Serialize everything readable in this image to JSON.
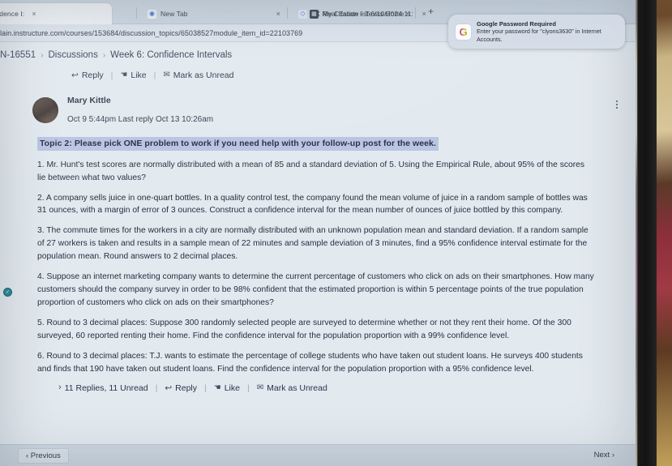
{
  "browser": {
    "tabs": [
      {
        "label": "nfidence I:",
        "favicon": "",
        "active": true,
        "close": "×"
      },
      {
        "label": "New Tab",
        "favicon": "chrome-icon",
        "active": false,
        "close": "×"
      },
      {
        "label": "TX Real Estate - Texas Home",
        "favicon": "folder-icon",
        "active": false,
        "close": "×"
      },
      {
        "label": "My Citation list 6/10/2024 11:",
        "favicon": "document-icon",
        "active": false,
        "close": "×"
      }
    ],
    "new_tab_button": "+",
    "url": "lain.instructure.com/courses/153684/discussion_topics/65038527module_item_id=22103769"
  },
  "notification": {
    "icon": "google-icon",
    "icon_glyph": "G",
    "title": "Google Password Required",
    "body": "Enter your password for \"clyons3630\" in Internet Accounts."
  },
  "breadcrumb": {
    "items": [
      "N-16551",
      "Discussions",
      "Week 6: Confidence Intervals"
    ],
    "separator": "›"
  },
  "top_actions": {
    "reply": "Reply",
    "like": "Like",
    "mark_unread": "Mark as Unread",
    "reply_icon": "↩",
    "like_icon": "ὄd",
    "unread_icon": "✉",
    "separator": "|"
  },
  "post": {
    "author": "Mary Kittle",
    "timestamps": "Oct 9 5:44pm  Last reply Oct 13 10:26am",
    "menu_icon": "kebab-menu-icon",
    "topic_heading": "Topic 2:  Please pick ONE problem to work if you need help with your follow-up post for the week.",
    "questions": [
      "1.  Mr. Hunt's test scores are normally distributed with a mean of 85 and a standard deviation of 5.  Using the Empirical Rule, about 95% of the scores lie between what two values?",
      "2.  A company sells juice in one-quart bottles.  In a quality control test, the company found the mean volume of juice in a random sample of bottles was 31 ounces, with a margin of error of 3 ounces. Construct a confidence interval for the mean number of ounces of juice bottled by this company.",
      "3.  The commute times for the workers in a city are normally distributed with an unknown population mean and standard deviation. If a random sample of 27 workers is taken and results in a sample mean of 22 minutes and sample deviation of 3 minutes, find a 95% confidence interval estimate for the population mean.  Round answers to 2 decimal places.",
      "4. Suppose an internet marketing company wants to determine the current percentage of customers who click on ads on their smartphones. How many customers should the company survey in order to be 98% confident that the estimated proportion is within 5 percentage points of the true population proportion of customers who click on ads on their smartphones?",
      "5.  Round to 3 decimal places:  Suppose 300 randomly selected people are surveyed to determine whether or not they rent their home. Of the 300 surveyed, 60 reported renting their home.  Find the confidence interval for the population proportion with a 99% confidence level.",
      "6.  Round to 3 decimal places:  T.J. wants to estimate the percentage of college students who have taken out student loans. He surveys 400 students and finds that 190 have taken out student loans.  Find the confidence interval for the population proportion with a 95% confidence level."
    ]
  },
  "bottom_actions": {
    "replies_count": "11 Replies, 11 Unread",
    "expand_icon": "›",
    "reply": "Reply",
    "like": "Like",
    "mark_unread": "Mark as Unread",
    "separator": "|"
  },
  "footer": {
    "previous": "‹ Previous",
    "next": "Next ›"
  },
  "left_badge": {
    "label": "✓"
  },
  "colors": {
    "highlight": "#b9c4e8",
    "link": "#24324a",
    "page_bg": "#e4ecf3",
    "chrome_bg": "#c9d6e4",
    "footer_bg": "#cfdae6"
  }
}
